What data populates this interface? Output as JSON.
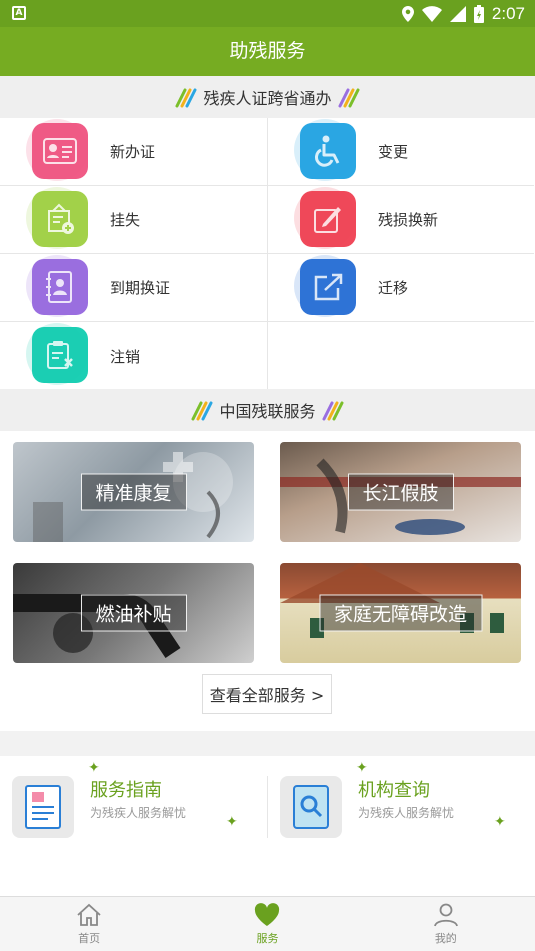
{
  "status_bar": {
    "time": "2:07",
    "badge": "A"
  },
  "header": {
    "title": "助残服务"
  },
  "section1": {
    "title": "残疾人证跨省通办"
  },
  "grid": [
    {
      "label": "新办证",
      "color": "#f05b86"
    },
    {
      "label": "变更",
      "color": "#2aa7e3"
    },
    {
      "label": "挂失",
      "color": "#a3d14a"
    },
    {
      "label": "残损换新",
      "color": "#f0495a"
    },
    {
      "label": "到期换证",
      "color": "#9a6ee0"
    },
    {
      "label": "迁移",
      "color": "#2f73d6"
    },
    {
      "label": "注销",
      "color": "#1ccfb4"
    }
  ],
  "section2": {
    "title": "中国残联服务"
  },
  "services": [
    {
      "label": "精准康复"
    },
    {
      "label": "长江假肢"
    },
    {
      "label": "燃油补贴"
    },
    {
      "label": "家庭无障碍改造"
    }
  ],
  "more_button": "查看全部服务 >",
  "guides": [
    {
      "title": "服务指南",
      "subtitle": "为残疾人服务解忧"
    },
    {
      "title": "机构查询",
      "subtitle": "为残疾人服务解忧"
    }
  ],
  "tabs": [
    {
      "label": "首页"
    },
    {
      "label": "服务"
    },
    {
      "label": "我的"
    }
  ],
  "colors": {
    "accent": "#76ac22",
    "status_bar": "#6aa11f"
  }
}
